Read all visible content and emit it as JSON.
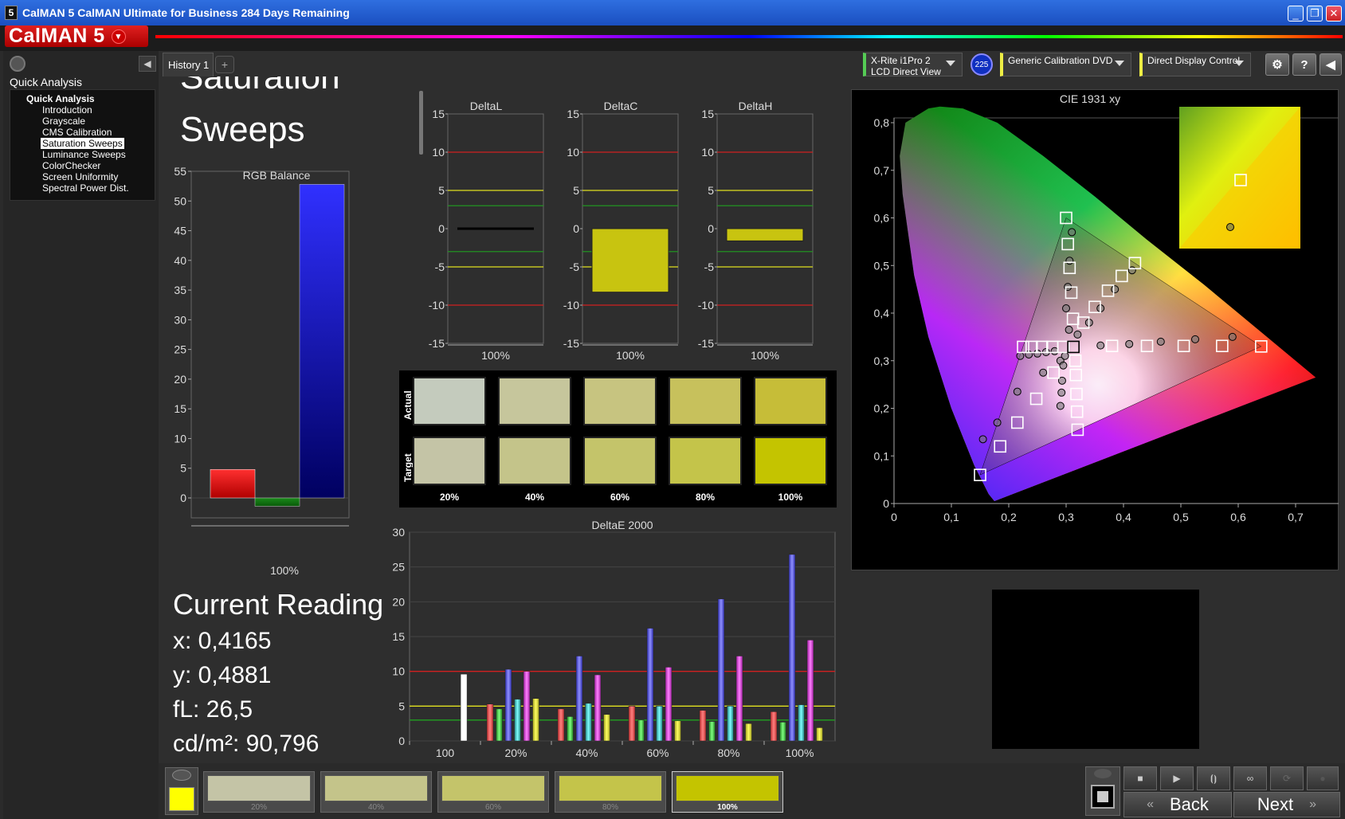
{
  "window": {
    "title": "CalMAN 5 CalMAN Ultimate for Business 284 Days Remaining",
    "brand": "CalMAN 5",
    "icon_app": "calman-5-icon"
  },
  "sidebar": {
    "header": "Quick Analysis",
    "tree_title": "Quick Analysis",
    "items": [
      "Introduction",
      "Grayscale",
      "CMS Calibration",
      "Saturation Sweeps",
      "Luminance Sweeps",
      "ColorChecker",
      "Screen Uniformity",
      "Spectral Power Dist."
    ],
    "selected": "Saturation Sweeps"
  },
  "tabs": {
    "history": "History 1",
    "add": "+"
  },
  "devices": {
    "meter_line1": "X-Rite i1Pro 2",
    "meter_line2": "LCD Direct View",
    "badge": "225",
    "source": "Generic Calibration DVD",
    "display": "Direct Display Control",
    "settings_icon": "gear-icon",
    "help": "?",
    "collapse_icon": "chevron-left-icon"
  },
  "page": {
    "title_partial": "Saturation",
    "title": "Sweeps"
  },
  "rgb_balance": {
    "title": "RGB Balance",
    "ticks": [
      "55",
      "50",
      "45",
      "40",
      "35",
      "30",
      "25",
      "20",
      "15",
      "10",
      "5",
      "0"
    ],
    "xlabel": "100%",
    "values": {
      "red": 4.8,
      "green": -1.4,
      "blue": 52.8
    }
  },
  "delta_charts": [
    {
      "title": "DeltaL",
      "value": 0,
      "xlabel": "100%"
    },
    {
      "title": "DeltaC",
      "value": -8.3,
      "xlabel": "100%"
    },
    {
      "title": "DeltaH",
      "value": -1.6,
      "xlabel": "100%"
    }
  ],
  "delta_ticks": [
    "15",
    "10",
    "5",
    "0",
    "-5",
    "-10",
    "-15"
  ],
  "swatches": {
    "row_actual": "Actual",
    "row_target": "Target",
    "labels": [
      "20%",
      "40%",
      "60%",
      "80%",
      "100%"
    ],
    "actual_colors": [
      "#c4cbbd",
      "#c6c69c",
      "#c7c480",
      "#c7c15c",
      "#c6bd38"
    ],
    "target_colors": [
      "#c4c4a6",
      "#c4c48a",
      "#c4c46a",
      "#c4c44a",
      "#c4c400"
    ]
  },
  "current_reading": {
    "title": "Current Reading",
    "x": "x: 0,4165",
    "y": "y: 0,4881",
    "fl": "fL: 26,5",
    "cdm2": "cd/m²: 90,796"
  },
  "chart_data": [
    {
      "type": "bar",
      "title": "RGB Balance",
      "categories": [
        "100%"
      ],
      "series": [],
      "values": [
        4.8,
        -1.4,
        52.8
      ],
      "ylim": [
        0,
        55
      ]
    },
    {
      "type": "bar",
      "title": "DeltaE 2000",
      "categories": [
        "100",
        "20%",
        "40%",
        "60%",
        "80%",
        "100%"
      ],
      "ylim": [
        0,
        30
      ],
      "ticks": [
        "30",
        "25",
        "20",
        "15",
        "10",
        "5",
        "0"
      ],
      "groups": [
        [
          9.6
        ],
        [
          5.3,
          4.6,
          10.3,
          6.0,
          10.0,
          6.1
        ],
        [
          4.6,
          3.5,
          12.2,
          5.4,
          9.5,
          3.8
        ],
        [
          5.0,
          3.0,
          16.2,
          5.0,
          10.6,
          2.9
        ],
        [
          4.4,
          2.8,
          20.4,
          5.0,
          12.2,
          2.5
        ],
        [
          4.2,
          2.7,
          26.8,
          5.2,
          14.5,
          1.9
        ]
      ],
      "reference_lines": [
        10,
        5,
        3
      ]
    },
    {
      "type": "scatter",
      "title": "CIE 1931 xy",
      "xlim": [
        0,
        0.8
      ],
      "ylim": [
        0,
        0.8
      ],
      "xticks": [
        "0",
        "0,1",
        "0,2",
        "0,3",
        "0,4",
        "0,5",
        "0,6",
        "0,7",
        "0,8"
      ],
      "yticks": [
        "0",
        "0,1",
        "0,2",
        "0,3",
        "0,4",
        "0,5",
        "0,6",
        "0,7",
        "0,8"
      ],
      "targets": [
        [
          0.64,
          0.33
        ],
        [
          0.572,
          0.331
        ],
        [
          0.505,
          0.331
        ],
        [
          0.441,
          0.331
        ],
        [
          0.38,
          0.331
        ],
        [
          0.3,
          0.6
        ],
        [
          0.303,
          0.545
        ],
        [
          0.306,
          0.495
        ],
        [
          0.309,
          0.443
        ],
        [
          0.312,
          0.388
        ],
        [
          0.15,
          0.06
        ],
        [
          0.185,
          0.12
        ],
        [
          0.215,
          0.17
        ],
        [
          0.248,
          0.22
        ],
        [
          0.278,
          0.275
        ],
        [
          0.225,
          0.329
        ],
        [
          0.24,
          0.329
        ],
        [
          0.258,
          0.329
        ],
        [
          0.276,
          0.329
        ],
        [
          0.295,
          0.329
        ],
        [
          0.32,
          0.155
        ],
        [
          0.319,
          0.193
        ],
        [
          0.318,
          0.23
        ],
        [
          0.317,
          0.27
        ],
        [
          0.316,
          0.3
        ],
        [
          0.42,
          0.505
        ],
        [
          0.397,
          0.478
        ],
        [
          0.373,
          0.447
        ],
        [
          0.35,
          0.413
        ],
        [
          0.33,
          0.38
        ],
        [
          0.3127,
          0.329
        ]
      ],
      "actuals": [
        [
          0.59,
          0.35
        ],
        [
          0.525,
          0.345
        ],
        [
          0.465,
          0.34
        ],
        [
          0.41,
          0.335
        ],
        [
          0.36,
          0.332
        ],
        [
          0.31,
          0.57
        ],
        [
          0.306,
          0.51
        ],
        [
          0.303,
          0.455
        ],
        [
          0.3,
          0.41
        ],
        [
          0.305,
          0.365
        ],
        [
          0.155,
          0.135
        ],
        [
          0.18,
          0.17
        ],
        [
          0.215,
          0.235
        ],
        [
          0.26,
          0.275
        ],
        [
          0.29,
          0.3
        ],
        [
          0.22,
          0.31
        ],
        [
          0.235,
          0.313
        ],
        [
          0.25,
          0.315
        ],
        [
          0.265,
          0.318
        ],
        [
          0.28,
          0.32
        ],
        [
          0.29,
          0.205
        ],
        [
          0.292,
          0.233
        ],
        [
          0.293,
          0.258
        ],
        [
          0.295,
          0.29
        ],
        [
          0.298,
          0.31
        ],
        [
          0.415,
          0.49
        ],
        [
          0.385,
          0.45
        ],
        [
          0.36,
          0.41
        ],
        [
          0.34,
          0.38
        ],
        [
          0.32,
          0.355
        ]
      ]
    }
  ],
  "cie": {
    "title": "CIE 1931 xy"
  },
  "deltae": {
    "title": "DeltaE 2000"
  },
  "bottom": {
    "current_color": "#ffff00",
    "patches": [
      {
        "label": "20%",
        "color": "#c4c4a6"
      },
      {
        "label": "40%",
        "color": "#c4c48a"
      },
      {
        "label": "60%",
        "color": "#c4c46a"
      },
      {
        "label": "80%",
        "color": "#c4c44a"
      },
      {
        "label": "100%",
        "color": "#c4c400"
      }
    ],
    "back": "Back",
    "next": "Next"
  }
}
